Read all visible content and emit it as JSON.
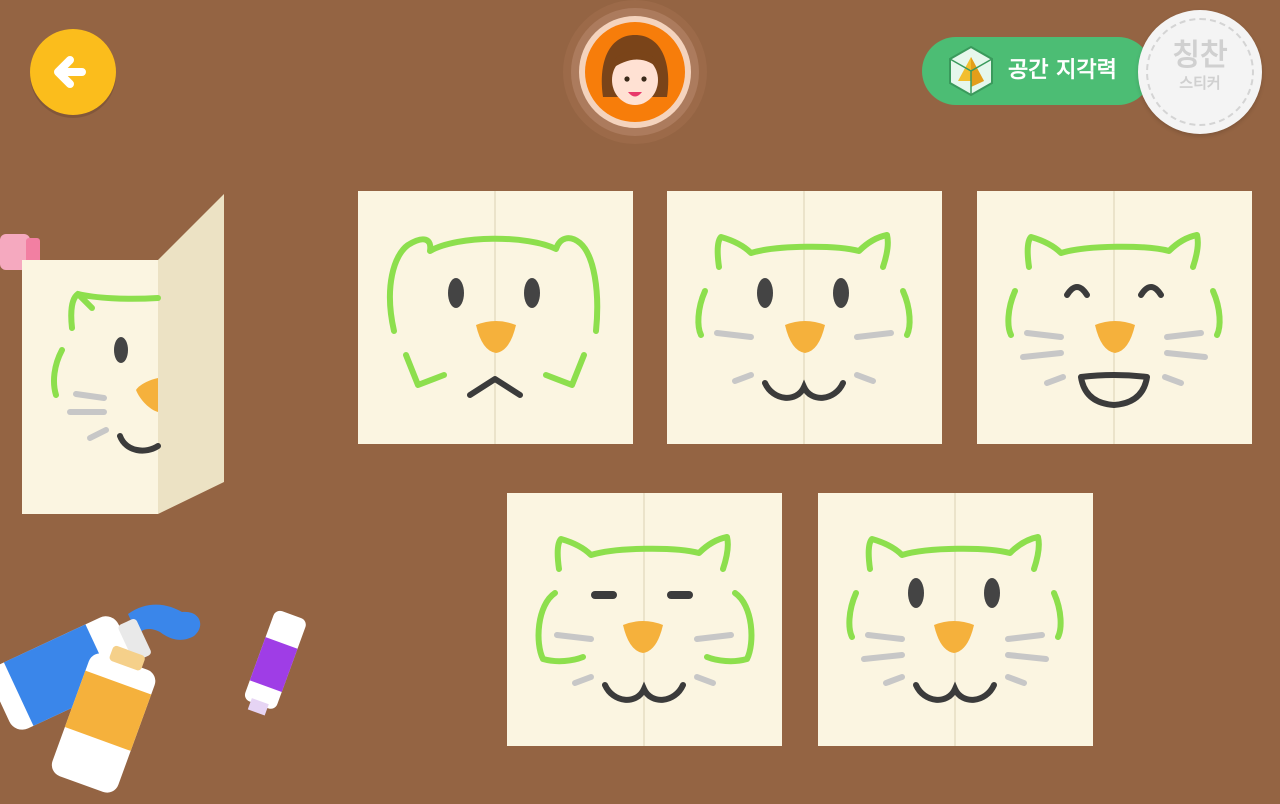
{
  "header": {
    "back_icon": "arrow-left-icon",
    "avatar_icon": "girl-avatar-icon",
    "skill_badge": {
      "label": "공간 지각력",
      "icon": "cube-icon",
      "color": "#4cbd74"
    },
    "praise_sticker": {
      "main": "칭찬",
      "sub": "스티커"
    }
  },
  "preview": {
    "description_icon": "half-cat-card-icon"
  },
  "choices": [
    {
      "id": 1,
      "expression": "round-face-downturned-mouth"
    },
    {
      "id": 2,
      "expression": "dot-eyes-smile"
    },
    {
      "id": 3,
      "expression": "closed-eyes-big-smile"
    },
    {
      "id": 4,
      "expression": "sleepy-eyes-smile"
    },
    {
      "id": 5,
      "expression": "dot-eyes-smile-small"
    }
  ],
  "colors": {
    "background": "#946443",
    "back_button": "#fbbd1c",
    "avatar_ring": "#f77d0a",
    "card": "#fbf5e1",
    "line": "#8ddf4d",
    "nose": "#f5b13c"
  }
}
